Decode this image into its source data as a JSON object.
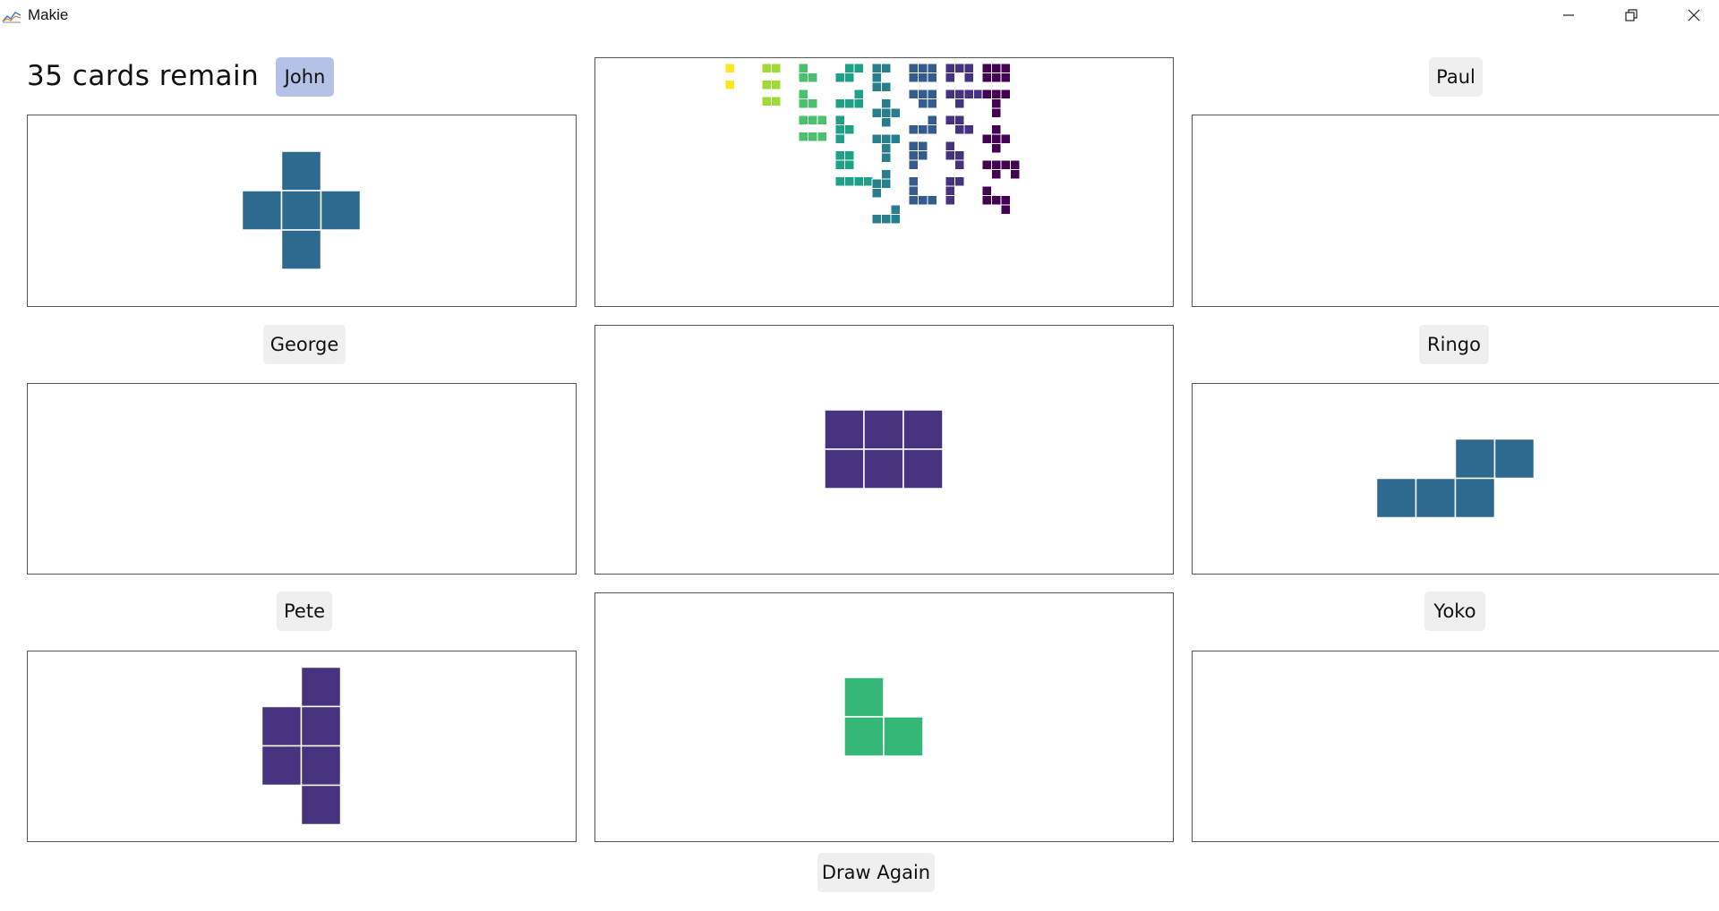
{
  "window": {
    "title": "Makie"
  },
  "status": {
    "cards_remain": "35 cards remain"
  },
  "players": {
    "john": "John",
    "paul": "Paul",
    "george": "George",
    "ringo": "Ringo",
    "pete": "Pete",
    "yoko": "Yoko"
  },
  "active_player": "John",
  "actions": {
    "draw_again": "Draw Again"
  },
  "colors": {
    "yellow": "#fde725",
    "lime": "#a0da39",
    "green": "#4ac16d",
    "teal": "#1fa187",
    "steel": "#277f8e",
    "blue": "#365c8d",
    "indigo": "#46327e",
    "purple": "#440154",
    "active_button": "#b3c2e6"
  },
  "cards": {
    "john": {
      "shape": "plus",
      "color": "#2e6a8f",
      "cells": [
        [
          1,
          0
        ],
        [
          0,
          1
        ],
        [
          1,
          1
        ],
        [
          2,
          1
        ],
        [
          1,
          2
        ]
      ]
    },
    "paul": null,
    "george": null,
    "ringo": {
      "shape": "S",
      "color": "#2e6a8f",
      "cells": [
        [
          2,
          0
        ],
        [
          3,
          0
        ],
        [
          0,
          1
        ],
        [
          1,
          1
        ],
        [
          2,
          1
        ]
      ]
    },
    "pete": {
      "shape": "P-vertical",
      "color": "#46327e",
      "cells": [
        [
          1,
          0
        ],
        [
          0,
          1
        ],
        [
          1,
          1
        ],
        [
          0,
          2
        ],
        [
          1,
          2
        ],
        [
          1,
          3
        ]
      ]
    },
    "yoko": null,
    "center_drawn": {
      "shape": "2x3 rectangle",
      "color": "#46327e",
      "cells": [
        [
          0,
          0
        ],
        [
          1,
          0
        ],
        [
          2,
          0
        ],
        [
          0,
          1
        ],
        [
          1,
          1
        ],
        [
          2,
          1
        ]
      ]
    },
    "center_next": {
      "shape": "L-tromino",
      "color": "#35b779",
      "cells": [
        [
          0,
          0
        ],
        [
          0,
          1
        ],
        [
          1,
          1
        ]
      ]
    }
  },
  "deck_overview": {
    "columns": [
      {
        "color": "#fde725",
        "shapes": [
          [
            [
              0,
              0
            ]
          ],
          [
            [
              0,
              0
            ]
          ]
        ]
      },
      {
        "color": "#a0da39",
        "shapes": [
          [
            [
              0,
              0
            ],
            [
              1,
              0
            ]
          ],
          [
            [
              0,
              0
            ],
            [
              1,
              0
            ]
          ],
          [
            [
              0,
              0
            ],
            [
              1,
              0
            ]
          ]
        ]
      },
      {
        "color": "#4ac16d",
        "shapes": [
          [
            [
              0,
              0
            ],
            [
              0,
              1
            ],
            [
              1,
              1
            ]
          ],
          [
            [
              0,
              0
            ],
            [
              0,
              1
            ],
            [
              1,
              1
            ]
          ],
          [
            [
              0,
              0
            ],
            [
              1,
              0
            ],
            [
              2,
              0
            ]
          ],
          [
            [
              0,
              0
            ],
            [
              1,
              0
            ],
            [
              2,
              0
            ]
          ]
        ]
      },
      {
        "color": "#1fa187",
        "shapes": [
          [
            [
              1,
              0
            ],
            [
              2,
              0
            ],
            [
              0,
              1
            ],
            [
              1,
              1
            ]
          ],
          [
            [
              2,
              0
            ],
            [
              0,
              1
            ],
            [
              1,
              1
            ],
            [
              2,
              1
            ]
          ],
          [
            [
              0,
              0
            ],
            [
              0,
              1
            ],
            [
              1,
              1
            ],
            [
              0,
              2
            ]
          ],
          [
            [
              0,
              0
            ],
            [
              1,
              0
            ],
            [
              0,
              1
            ],
            [
              1,
              1
            ]
          ],
          [
            [
              0,
              0
            ],
            [
              1,
              0
            ],
            [
              2,
              0
            ],
            [
              3,
              0
            ]
          ]
        ]
      },
      {
        "color": "#277f8e",
        "shapes": [
          [
            [
              0,
              0
            ],
            [
              1,
              0
            ],
            [
              0,
              1
            ],
            [
              0,
              2
            ],
            [
              1,
              2
            ]
          ],
          [
            [
              1,
              0
            ],
            [
              0,
              1
            ],
            [
              1,
              1
            ],
            [
              2,
              1
            ],
            [
              1,
              2
            ]
          ],
          [
            [
              0,
              0
            ],
            [
              1,
              0
            ],
            [
              2,
              0
            ],
            [
              1,
              1
            ],
            [
              1,
              2
            ]
          ],
          [
            [
              1,
              0
            ],
            [
              0,
              1
            ],
            [
              1,
              1
            ],
            [
              0,
              2
            ]
          ],
          [
            [
              2,
              0
            ],
            [
              0,
              1
            ],
            [
              1,
              1
            ],
            [
              2,
              1
            ]
          ]
        ]
      },
      {
        "color": "#365c8d",
        "shapes": [
          [
            [
              0,
              0
            ],
            [
              1,
              0
            ],
            [
              2,
              0
            ],
            [
              0,
              1
            ],
            [
              1,
              1
            ],
            [
              2,
              1
            ]
          ],
          [
            [
              0,
              0
            ],
            [
              1,
              0
            ],
            [
              2,
              0
            ],
            [
              1,
              1
            ],
            [
              2,
              1
            ]
          ],
          [
            [
              2,
              0
            ],
            [
              0,
              1
            ],
            [
              1,
              1
            ],
            [
              2,
              1
            ]
          ],
          [
            [
              0,
              0
            ],
            [
              1,
              0
            ],
            [
              0,
              1
            ],
            [
              1,
              1
            ],
            [
              0,
              2
            ]
          ],
          [
            [
              0,
              0
            ],
            [
              0,
              1
            ],
            [
              0,
              2
            ],
            [
              1,
              2
            ],
            [
              2,
              2
            ]
          ]
        ]
      },
      {
        "color": "#46327e",
        "shapes": [
          [
            [
              0,
              0
            ],
            [
              1,
              0
            ],
            [
              2,
              0
            ],
            [
              0,
              1
            ],
            [
              2,
              1
            ]
          ],
          [
            [
              0,
              0
            ],
            [
              1,
              0
            ],
            [
              2,
              0
            ],
            [
              3,
              0
            ],
            [
              1,
              1
            ]
          ],
          [
            [
              0,
              0
            ],
            [
              1,
              0
            ],
            [
              1,
              1
            ],
            [
              2,
              1
            ]
          ],
          [
            [
              0,
              0
            ],
            [
              0,
              1
            ],
            [
              1,
              1
            ],
            [
              1,
              2
            ]
          ],
          [
            [
              0,
              0
            ],
            [
              1,
              0
            ],
            [
              0,
              1
            ],
            [
              0,
              2
            ]
          ]
        ]
      },
      {
        "color": "#440154",
        "shapes": [
          [
            [
              0,
              0
            ],
            [
              1,
              0
            ],
            [
              2,
              0
            ],
            [
              0,
              1
            ],
            [
              1,
              1
            ],
            [
              2,
              1
            ]
          ],
          [
            [
              0,
              0
            ],
            [
              1,
              0
            ],
            [
              2,
              0
            ],
            [
              1,
              1
            ],
            [
              1,
              2
            ]
          ],
          [
            [
              1,
              0
            ],
            [
              0,
              1
            ],
            [
              1,
              1
            ],
            [
              2,
              1
            ],
            [
              1,
              2
            ]
          ],
          [
            [
              0,
              0
            ],
            [
              1,
              0
            ],
            [
              2,
              0
            ],
            [
              3,
              0
            ],
            [
              1,
              1
            ],
            [
              3,
              1
            ]
          ],
          [
            [
              0,
              0
            ],
            [
              0,
              1
            ],
            [
              1,
              1
            ],
            [
              2,
              1
            ],
            [
              2,
              2
            ]
          ]
        ]
      }
    ]
  }
}
